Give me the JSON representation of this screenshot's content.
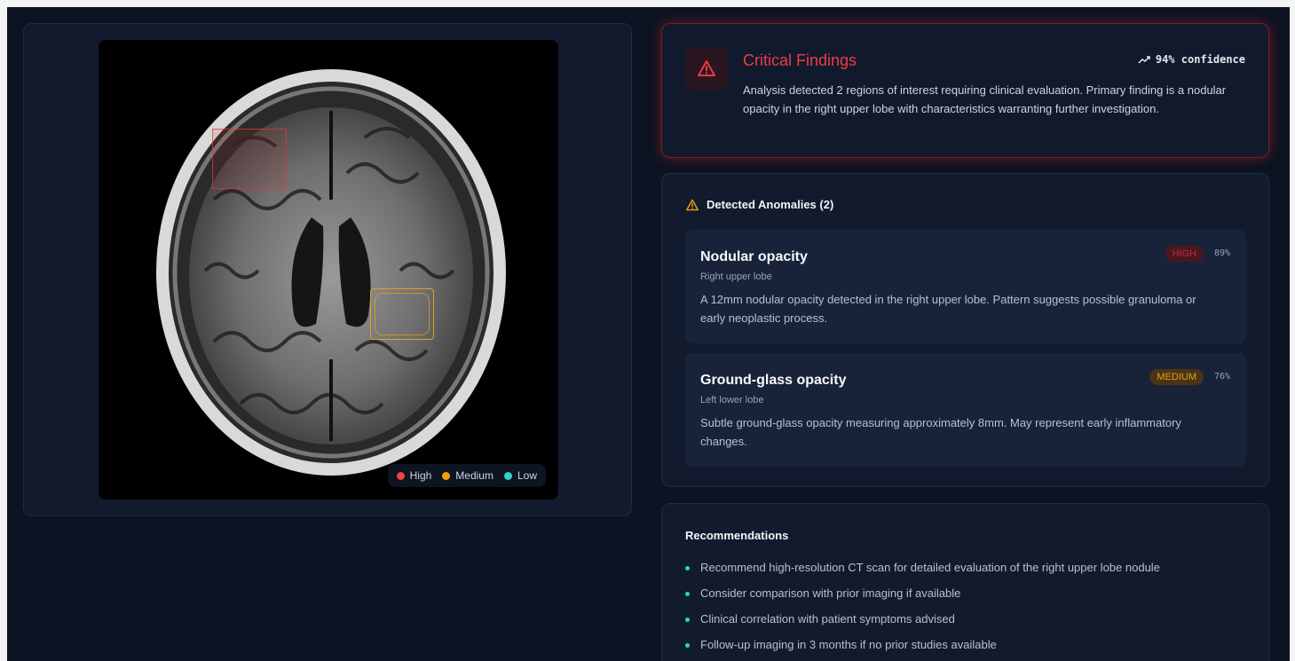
{
  "colors": {
    "high": "#ef4444",
    "medium": "#f59e0b",
    "low": "#2dd4bf",
    "critical_accent": "#ef3b43",
    "background": "#0c1322"
  },
  "scan": {
    "legend": [
      {
        "label": "High",
        "color": "#ef4444"
      },
      {
        "label": "Medium",
        "color": "#f59e0b"
      },
      {
        "label": "Low",
        "color": "#2dd4bf"
      }
    ]
  },
  "critical": {
    "icon": "warning-triangle-icon",
    "title": "Critical Findings",
    "confidence_icon": "trending-up-icon",
    "confidence": "94% confidence",
    "text": "Analysis detected 2 regions of interest requiring clinical evaluation. Primary finding is a nodular opacity in the right upper lobe with characteristics warranting further investigation."
  },
  "anomalies": {
    "icon": "warning-triangle-icon",
    "heading": "Detected Anomalies (2)",
    "items": [
      {
        "name": "Nodular opacity",
        "location": "Right upper lobe",
        "severity": "HIGH",
        "percent": "89%",
        "description": "A 12mm nodular opacity detected in the right upper lobe. Pattern suggests possible granuloma or early neoplastic process."
      },
      {
        "name": "Ground-glass opacity",
        "location": "Left lower lobe",
        "severity": "MEDIUM",
        "percent": "76%",
        "description": "Subtle ground-glass opacity measuring approximately 8mm. May represent early inflammatory changes."
      }
    ]
  },
  "recommendations": {
    "heading": "Recommendations",
    "items": [
      "Recommend high-resolution CT scan for detailed evaluation of the right upper lobe nodule",
      "Consider comparison with prior imaging if available",
      "Clinical correlation with patient symptoms advised",
      "Follow-up imaging in 3 months if no prior studies available"
    ]
  }
}
